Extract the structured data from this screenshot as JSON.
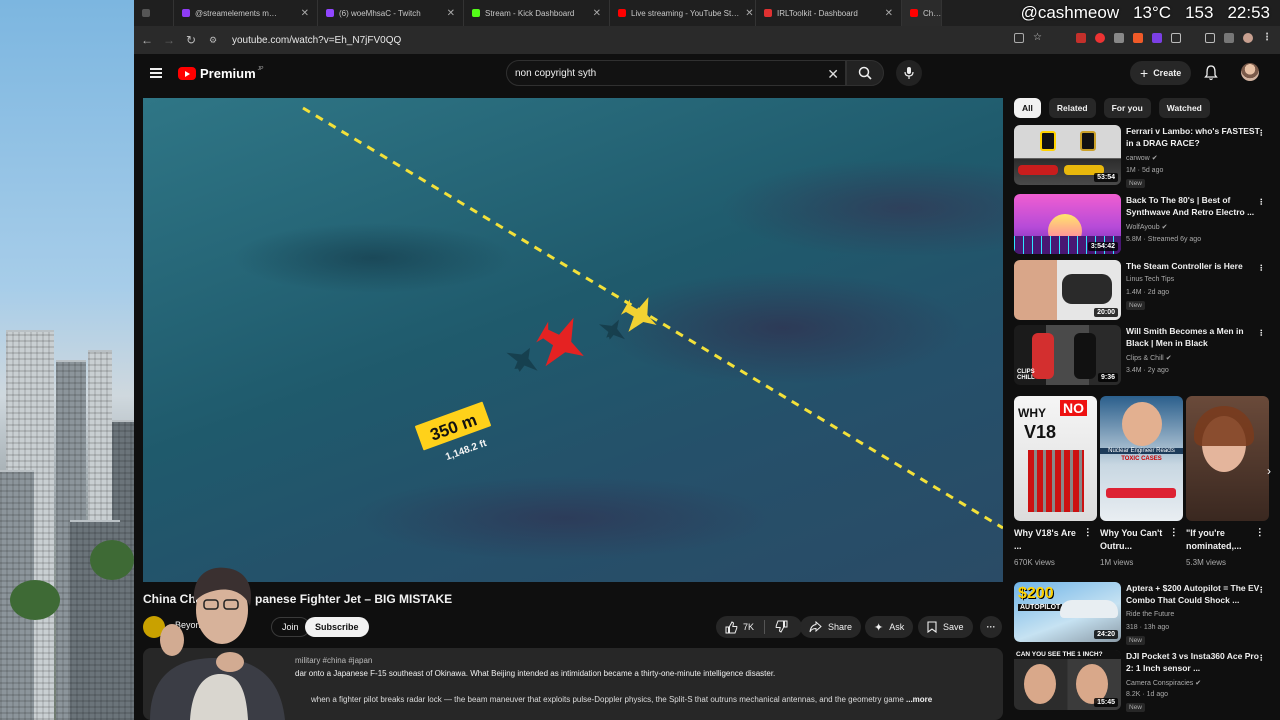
{
  "tabs": [
    {
      "label": "",
      "color": "#555555"
    },
    {
      "label": "@streamelements m…",
      "color": "#8f3cf5"
    },
    {
      "label": "(6) woeMhsaC - Twitch",
      "color": "#9146ff"
    },
    {
      "label": "Stream - Kick Dashboard",
      "color": "#53fc18"
    },
    {
      "label": "Live streaming - YouTube St…",
      "color": "#ff0000"
    },
    {
      "label": "IRLToolkit - Dashboard",
      "color": "#e03131"
    },
    {
      "label": "Ch…",
      "color": "#ff0000"
    }
  ],
  "overlay": {
    "handle": "@cashmeow",
    "temp": "13°C",
    "count": "153",
    "time": "22:53"
  },
  "address": {
    "url": "youtube.com/watch?v=Eh_N7jFV0QQ"
  },
  "yt": {
    "logo": "Premium",
    "logo_region": "JP",
    "search_value": "non copyright syth",
    "create_label": "Create"
  },
  "video": {
    "distance_m": "350 m",
    "distance_ft": "1,148.2 ft",
    "title_left": "China Chall",
    "title_right": "panese Fighter Jet – BIG MISTAKE",
    "channel": "Beyon",
    "join_label": "Join",
    "subscribe_label": "Subscribe",
    "likes": "7K",
    "share_label": "Share",
    "ask_label": "Ask",
    "save_label": "Save",
    "desc_tags": "military #china #japan",
    "desc_line1": "dar onto a Japanese F-15 southeast of Okinawa. What Beijing intended as intimidation became a thirty-one-minute intelligence disaster.",
    "desc_line2": "when a fighter pilot breaks radar lock — the beam maneuver that exploits pulse-Doppler physics, the Split-S that outruns mechanical antennas, and the geometry game",
    "desc_more": "...more"
  },
  "chips": [
    "All",
    "Related",
    "For you",
    "Watched"
  ],
  "recs": [
    {
      "title": "Ferrari v Lambo: who's FASTEST in a DRAG RACE?",
      "channel": "carwow",
      "meta": "1M · 5d ago",
      "badge": "New",
      "duration": "53:54",
      "thumb": "ferrari"
    },
    {
      "title": "Back To The 80's | Best of Synthwave And Retro Electro ...",
      "channel": "WolfAyoub",
      "meta": "5.8M · Streamed 6y ago",
      "badge": "",
      "duration": "3:54:42",
      "thumb": "synth"
    },
    {
      "title": "The Steam Controller is Here",
      "channel": "Linus Tech Tips",
      "meta": "1.4M · 2d ago",
      "badge": "New",
      "duration": "20:00",
      "thumb": "steam"
    },
    {
      "title": "Will Smith Becomes a Men in Black | Men in Black",
      "channel": "Clips & Chill",
      "meta": "3.4M · 2y ago",
      "badge": "",
      "duration": "9:36",
      "thumb": "mib"
    }
  ],
  "shorts": [
    {
      "title": "Why V18's Are ...",
      "views": "670K views"
    },
    {
      "title": "Why You Can't Outru...",
      "views": "1M views"
    },
    {
      "title": "\"If you're nominated,...",
      "views": "5.3M views"
    }
  ],
  "recs2": [
    {
      "title": "Aptera + $200 Autopilot = The EV Combo That Could Shock ...",
      "channel": "Ride the Future",
      "meta": "318 · 13h ago",
      "badge": "New",
      "duration": "24:20"
    },
    {
      "title": "DJI Pocket 3 vs Insta360 Ace Pro 2: 1 Inch sensor ...",
      "channel": "Camera Conspiracies",
      "meta": "8.2K · 1d ago",
      "badge": "New",
      "duration": "15:45"
    }
  ],
  "thumb_text": {
    "short1_a": "WHY",
    "short1_b": "NO",
    "short1_c": "V18",
    "short2_a": "Nuclear Engineer Reacts",
    "short2_b": "TOXIC CASES",
    "rec5_a": "$200",
    "rec5_b": "AUTOPILOT",
    "rec6_a": "CAN YOU SEE THE 1 INCH?",
    "rec4_a": "CLIPS CHILL"
  }
}
